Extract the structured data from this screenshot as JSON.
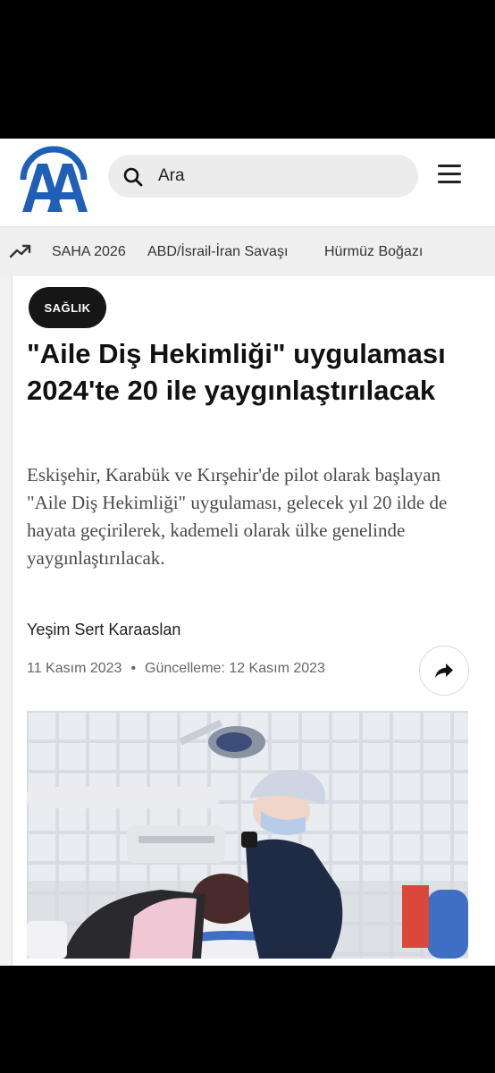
{
  "header": {
    "logo_text": "AA",
    "search": {
      "placeholder": "Ara"
    }
  },
  "trending": {
    "items": [
      "SAHA 2026",
      "ABD/İsrail-İran Savaşı",
      "Hürmüz Boğazı"
    ]
  },
  "article": {
    "category": "SAĞLIK",
    "title": "\"Aile Diş Hekimliği\" uygulaması 2024'te 20 ile yaygınlaştırılacak",
    "summary": "Eskişehir, Karabük ve Kırşehir'de pilot olarak başlayan \"Aile Diş Hekimliği\" uygulaması, gelecek yıl 20 ilde de hayata geçirilerek, kademeli olarak ülke genelinde yaygınlaştırılacak.",
    "author": "Yeşim Sert Karaaslan",
    "date": "11 Kasım 2023",
    "separator": "•",
    "updated": "Güncelleme: 12 Kasım 2023"
  },
  "icons": {
    "search": "search-icon",
    "menu": "menu-icon",
    "trend": "trending-icon",
    "share": "share-icon"
  },
  "colors": {
    "brand_blue": "#1f5fb7",
    "category_bg": "#161616"
  }
}
